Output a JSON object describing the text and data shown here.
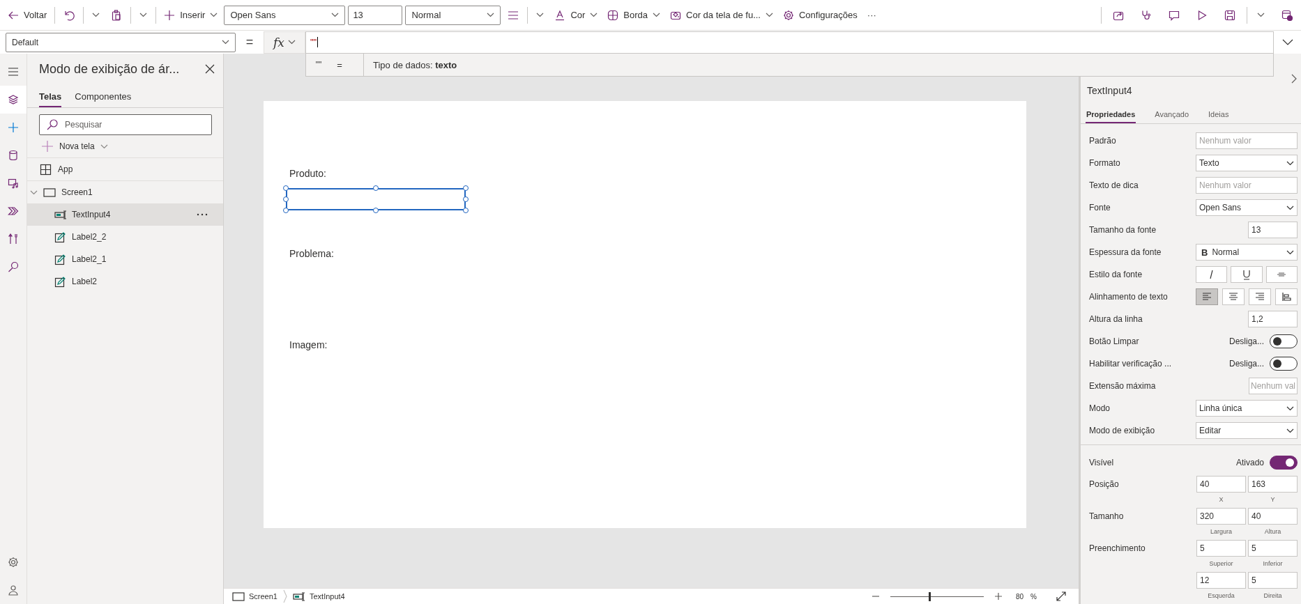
{
  "toolbar": {
    "items": [
      {
        "kind": "button",
        "label": "Voltar"
      },
      {
        "kind": "icon-menu"
      },
      {
        "kind": "icon-menu"
      },
      {
        "kind": "menu",
        "label": "Inserir"
      },
      {
        "kind": "select",
        "value": "Open Sans"
      },
      {
        "kind": "field",
        "value": "13"
      },
      {
        "kind": "select",
        "value": "Normal"
      },
      {
        "kind": "icon-menu"
      },
      {
        "kind": "menu",
        "label": "Cor"
      },
      {
        "kind": "menu",
        "label": "Borda"
      },
      {
        "kind": "menu",
        "label": "Cor da tela de fu..."
      },
      {
        "kind": "button",
        "label": "Configurações"
      },
      {
        "kind": "button",
        "label": "···"
      }
    ]
  },
  "formula_bar": {
    "property": "Default",
    "equals": "=",
    "fx": "fx",
    "value": "\"\"",
    "result": {
      "value": "\"\"",
      "equals": "=",
      "type": "Tipo de dados: **texto**"
    }
  },
  "left_rail": {
    "items": [
      {
        "selected": true
      },
      {
        "selected": false
      },
      {
        "selected": false
      },
      {
        "selected": false
      },
      {
        "selected": false
      },
      {
        "selected": false
      },
      {
        "selected": false
      }
    ]
  },
  "tree_panel": {
    "title": "Modo de exibição de ár...",
    "tabs": [
      {
        "label": "Telas",
        "selected": true
      },
      {
        "label": "Componentes",
        "selected": false
      }
    ],
    "search": {
      "placeholder": "Pesquisar"
    },
    "new_screen": "Nova tela",
    "tree": [
      {
        "kind": "app",
        "label": "App",
        "selected": false
      },
      {
        "kind": "screen",
        "label": "Screen1",
        "selected": false,
        "expanded": true,
        "children": [
          {
            "kind": "textinput",
            "label": "TextInput4",
            "selected": true
          },
          {
            "kind": "label",
            "label": "Label2_2",
            "selected": false
          },
          {
            "kind": "label",
            "label": "Label2_1",
            "selected": false
          },
          {
            "kind": "label",
            "label": "Label2",
            "selected": false
          }
        ]
      }
    ]
  },
  "canvas": {
    "controls": [
      {
        "kind": "label",
        "text": "Produto:",
        "selected": false
      },
      {
        "kind": "textinput",
        "selected": true
      },
      {
        "kind": "label",
        "text": "Problema:",
        "selected": false
      },
      {
        "kind": "label",
        "text": "Imagem:",
        "selected": false
      }
    ]
  },
  "properties_panel": {
    "title": "TextInput4",
    "tabs": [
      {
        "label": "Propriedades",
        "selected": true
      },
      {
        "label": "Avançado",
        "selected": false
      },
      {
        "label": "Ideias",
        "selected": false
      }
    ],
    "rows": [
      {
        "kind": "input",
        "label": "Padrão",
        "placeholder": "Nenhum valor"
      },
      {
        "kind": "select",
        "label": "Formato",
        "value": "Texto"
      },
      {
        "kind": "input",
        "label": "Texto de dica",
        "placeholder": "Nenhum valor"
      },
      {
        "kind": "select",
        "label": "Fonte",
        "value": "Open Sans"
      },
      {
        "kind": "number",
        "label": "Tamanho da fonte",
        "value": "13"
      },
      {
        "kind": "weight",
        "label": "Espessura da fonte",
        "glyph": "B",
        "value": "Normal"
      },
      {
        "kind": "style",
        "label": "Estilo da fonte",
        "options": [
          {
            "selected": false
          },
          {
            "selected": false
          },
          {
            "selected": false
          }
        ]
      },
      {
        "kind": "align",
        "label": "Alinhamento de texto",
        "options": [
          {
            "selected": true
          },
          {
            "selected": false
          },
          {
            "selected": false
          },
          {
            "selected": false
          }
        ]
      },
      {
        "kind": "number",
        "label": "Altura da linha",
        "value": "1,2"
      },
      {
        "kind": "toggle",
        "label": "Botão Limpar",
        "state": "Desliga...",
        "on": false
      },
      {
        "kind": "toggle",
        "label": "Habilitar verificação ...",
        "state": "Desliga...",
        "on": false
      },
      {
        "kind": "number",
        "label": "Extensão máxima",
        "placeholder": "Nenhum val"
      },
      {
        "kind": "select",
        "label": "Modo",
        "value": "Linha única"
      },
      {
        "kind": "select",
        "label": "Modo de exibição",
        "value": "Editar"
      }
    ],
    "rows_2": [
      {
        "kind": "toggle",
        "label": "Visível",
        "state": "Ativado",
        "on": true
      },
      {
        "kind": "pair",
        "label": "Posição",
        "fields": [
          {
            "value": "40",
            "caption": "X"
          },
          {
            "value": "163",
            "caption": "Y"
          }
        ]
      },
      {
        "kind": "pair",
        "label": "Tamanho",
        "fields": [
          {
            "value": "320",
            "caption": "Largura"
          },
          {
            "value": "40",
            "caption": "Altura"
          }
        ]
      },
      {
        "kind": "pair",
        "label": "Preenchimento",
        "fields": [
          {
            "value": "5",
            "caption": "Superior"
          },
          {
            "value": "5",
            "caption": "Inferior"
          }
        ]
      },
      {
        "kind": "pair",
        "fields": [
          {
            "value": "12",
            "caption": "Esquerda"
          },
          {
            "value": "5",
            "caption": "Direita"
          }
        ]
      }
    ]
  },
  "status_bar": {
    "breadcrumbs": [
      {
        "kind": "screen",
        "label": "Screen1"
      },
      {
        "kind": "textinput",
        "label": "TextInput4"
      }
    ],
    "zoom": {
      "level": 0.42,
      "value": "80",
      "unit": "%"
    }
  }
}
